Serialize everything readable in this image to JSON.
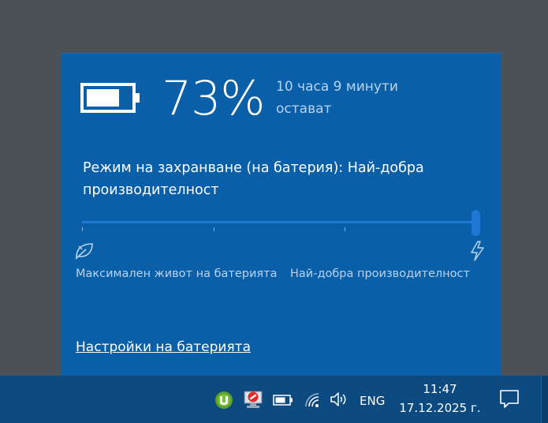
{
  "battery": {
    "percent_text": "73%",
    "percent_value": 73,
    "remaining_line1": "10 часа 9 минути",
    "remaining_line2": "остават"
  },
  "power_mode": {
    "title_line1": "Режим на захранване (на батерия): Най-добра",
    "title_line2": "производителност",
    "slider_position": 1.0,
    "tick_count": 4,
    "min_label": "Максимален живот на батерията",
    "max_label": "Най-добра производителност",
    "min_icon": "leaf-icon",
    "max_icon": "lightning-bolt-icon"
  },
  "settings_link": "Настройки на батерията",
  "taskbar": {
    "tray_icons": [
      "utorrent-icon",
      "blocked-network-icon",
      "battery-icon",
      "wifi-icon",
      "speaker-icon"
    ],
    "language": "ENG",
    "time": "11:47",
    "date": "17.12.2025 г.",
    "notification_icon": "action-center-icon"
  },
  "colors": {
    "flyout_bg": "#0a5fa9",
    "accent": "#1e78d4",
    "taskbar_bg": "#0d4a80",
    "secondary_text": "#b9d3ee"
  }
}
